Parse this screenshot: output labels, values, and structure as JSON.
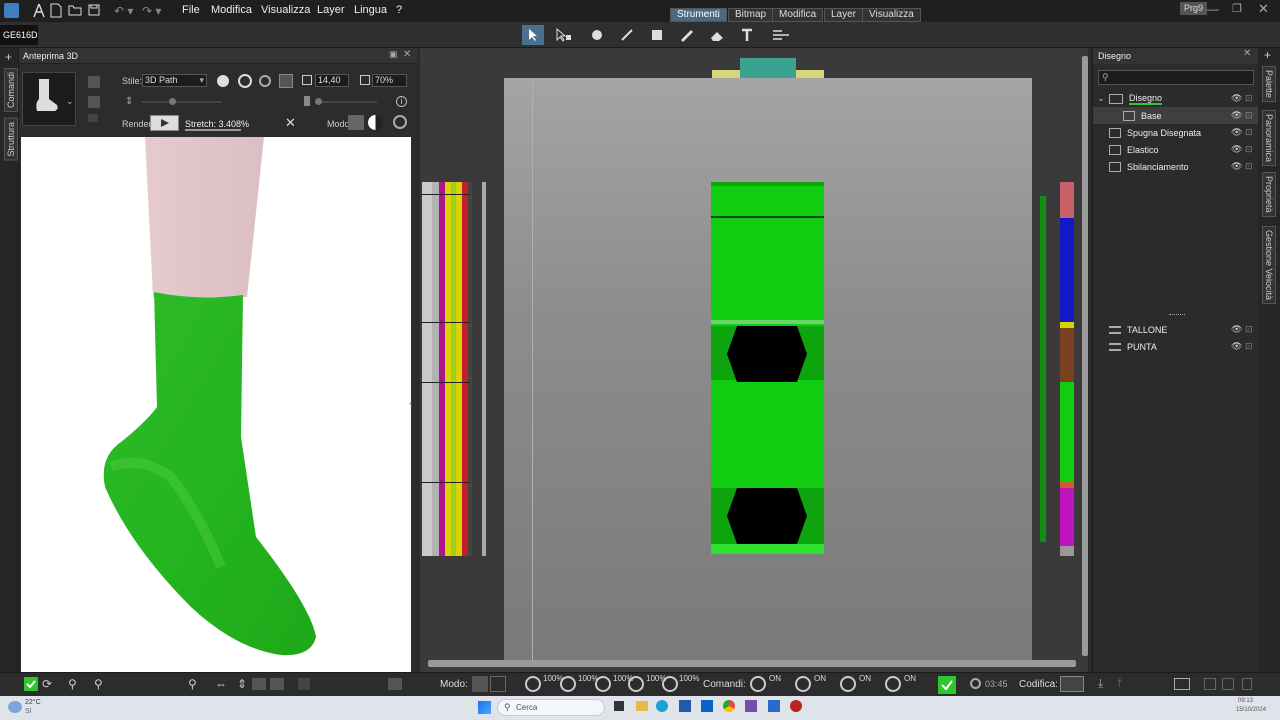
{
  "menubar": {
    "items": [
      "File",
      "Modifica",
      "Visualizza",
      "Layer",
      "Lingua",
      "?"
    ],
    "tabs": [
      "Strumenti",
      "Bitmap",
      "Modifica",
      "Layer",
      "Visualizza"
    ],
    "active_tab": "Strumenti",
    "doc_badge": "Prg9"
  },
  "doc_id": "GE616D",
  "preview": {
    "title": "Anteprima 3D",
    "stile_label": "Stile:",
    "stile_value": "3D Path",
    "size_value": "14,40",
    "zoom_value": "70%",
    "render_label": "Render:",
    "stretch": "Stretch: 3.408%",
    "modo_label": "Modo:"
  },
  "left_tabs": [
    "Comandi",
    "Struttura"
  ],
  "right_panel": {
    "title": "Disegno",
    "search_placeholder": "",
    "layers": [
      {
        "name": "Disegno",
        "indent": 0
      },
      {
        "name": "Base",
        "indent": 1
      },
      {
        "name": "Spugna Disegnata",
        "indent": 0
      },
      {
        "name": "Elastico",
        "indent": 0
      },
      {
        "name": "Sbilanciamento",
        "indent": 0
      }
    ],
    "extra_layers": [
      "TALLONE",
      "PUNTA"
    ]
  },
  "right_tabs": [
    "Palette",
    "Panoramica",
    "Proprietà",
    "Gestione Velocità"
  ],
  "bottombar": {
    "modo_label": "Modo:",
    "pct": [
      "100%",
      "100%",
      "100%",
      "100%",
      "100%"
    ],
    "comandi_label": "Comandi:",
    "on": [
      "ON",
      "ON",
      "ON",
      "ON"
    ],
    "time": "03:45",
    "codifica_label": "Codifica:"
  },
  "taskbar": {
    "weather_temp": "22°C",
    "weather_desc": "Sl",
    "search": "Cerca",
    "clock_time": "09:13",
    "clock_date": "15/10/2024"
  },
  "colors": {
    "accent": "#4b6a82",
    "sock_green": "#23b81f",
    "canvas_green": "#11cc11",
    "stripe_red": "#c41e2a",
    "stripe_yellow": "#d7d400",
    "stripe_magenta": "#b0148c",
    "stripe_blue": "#1218c8"
  }
}
